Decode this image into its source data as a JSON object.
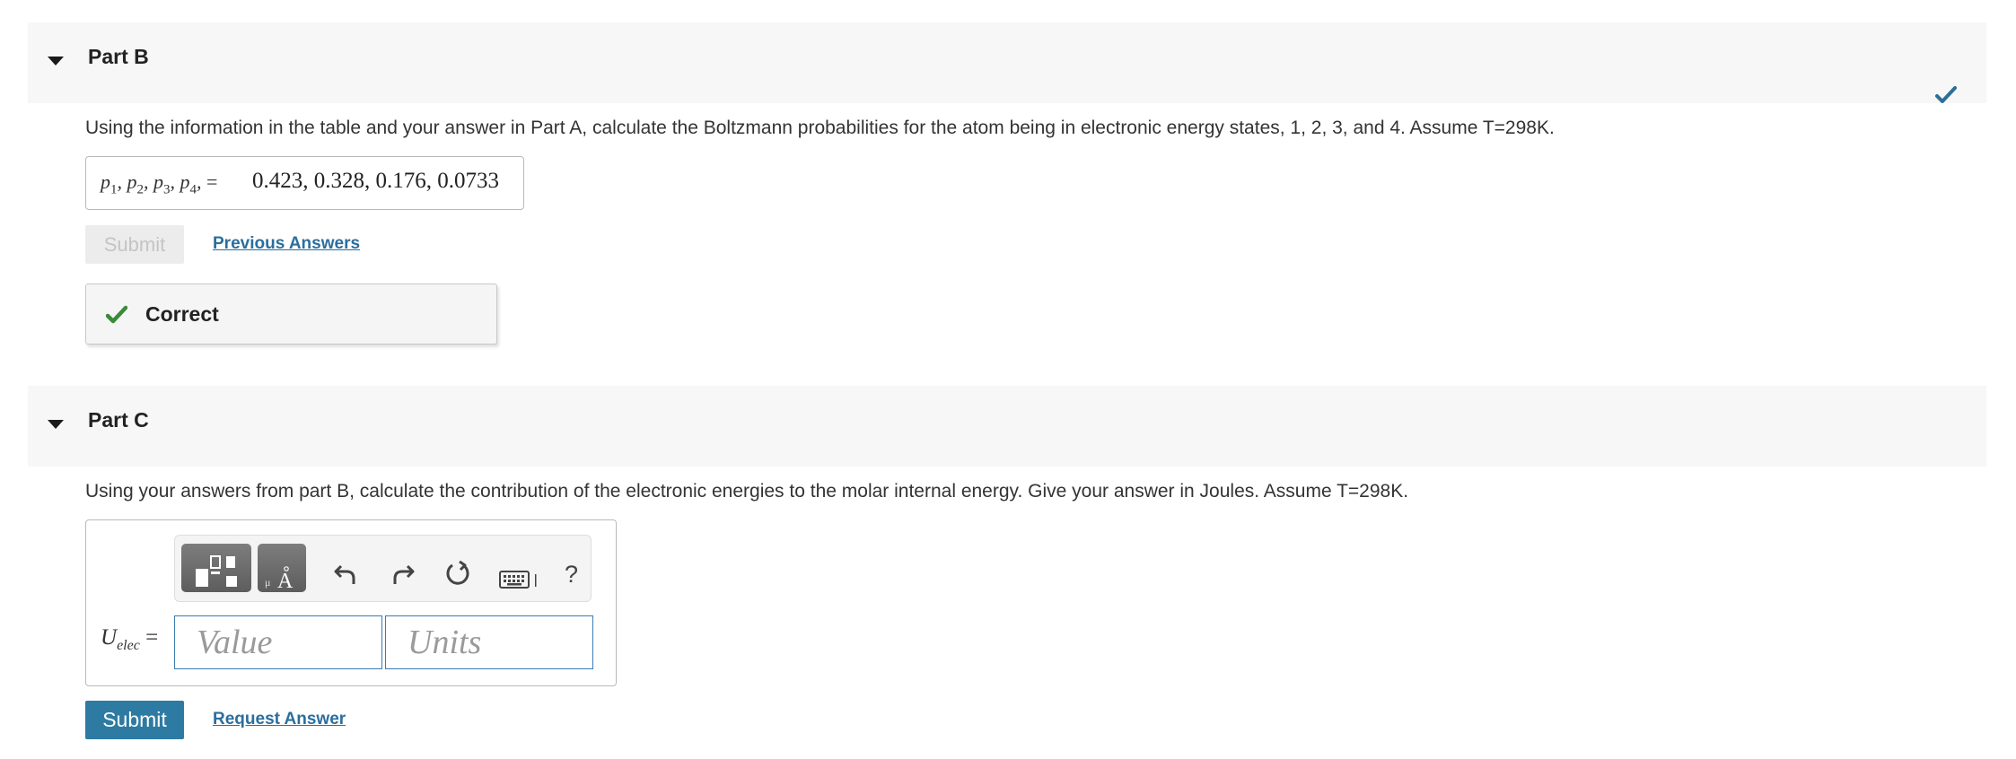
{
  "part_b": {
    "header": "Part B",
    "question": "Using the information in the table and your answer in Part A, calculate the Boltzmann probabilities for the atom being in electronic energy states, 1, 2, 3, and 4. Assume T=298K.",
    "answer_lhs_var": "p",
    "answer_lhs_subs": [
      "1",
      "2",
      "3",
      "4"
    ],
    "answer_equals": "=",
    "answer_value": "0.423, 0.328, 0.176, 0.0733",
    "submit_label": "Submit",
    "previous_answers_label": "Previous Answers",
    "feedback_label": "Correct"
  },
  "part_c": {
    "header": "Part C",
    "question": "Using your answers from part B, calculate the contribution of the electronic energies to the molar internal energy. Give your answer in Joules. Assume T=298K.",
    "label_var": "U",
    "label_sub": "elec",
    "label_equals": "=",
    "value_placeholder": "Value",
    "units_placeholder": "Units",
    "help_label": "?",
    "submit_label": "Submit",
    "request_answer_label": "Request Answer"
  },
  "colors": {
    "accent": "#2d7ba3",
    "link": "#2b6e9e",
    "correct_green": "#3a8a3a",
    "header_bg": "#f7f7f7"
  },
  "icons": [
    "caret-down-icon",
    "checkmark-icon",
    "templates-icon",
    "units-icon",
    "undo-icon",
    "redo-icon",
    "reset-icon",
    "keyboard-icon"
  ]
}
